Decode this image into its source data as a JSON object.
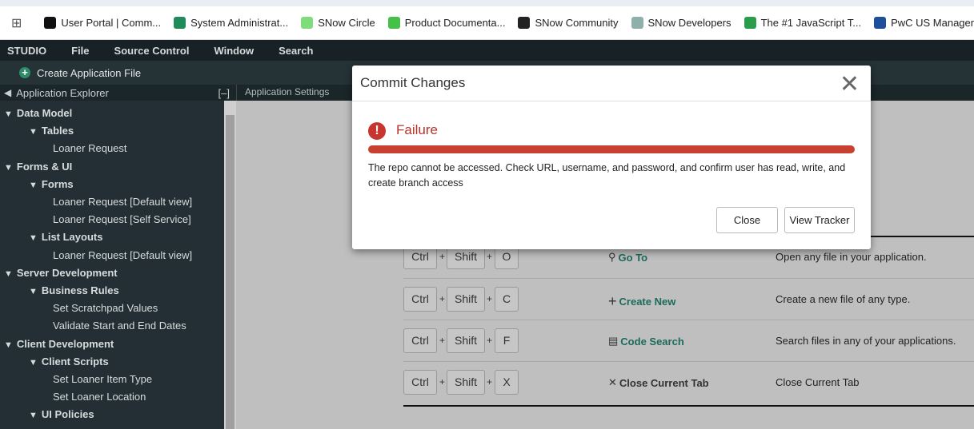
{
  "bookmarks": [
    {
      "label": "User Portal | Comm...",
      "color": "#111111"
    },
    {
      "label": "System Administrat...",
      "color": "#1f8a5a"
    },
    {
      "label": "SNow Circle",
      "color": "#7fdc7a"
    },
    {
      "label": "Product Documenta...",
      "color": "#45c14a"
    },
    {
      "label": "SNow Community",
      "color": "#222222"
    },
    {
      "label": "SNow Developers",
      "color": "#8fb0aa"
    },
    {
      "label": "The #1 JavaScript T...",
      "color": "#2a9d4a"
    },
    {
      "label": "PwC US Manageme...",
      "color": "#1e4f9a"
    }
  ],
  "menu": [
    "STUDIO",
    "File",
    "Source Control",
    "Window",
    "Search"
  ],
  "create_file": "Create Application File",
  "explorer": {
    "title": "Application Explorer",
    "collapse": "[–]"
  },
  "tab": "Application Settings",
  "tree": [
    {
      "label": "Data Model",
      "level": 0
    },
    {
      "label": "Tables",
      "level": 1
    },
    {
      "label": "Loaner Request",
      "level": 2
    },
    {
      "label": "Forms & UI",
      "level": 0
    },
    {
      "label": "Forms",
      "level": 1
    },
    {
      "label": "Loaner Request [Default view]",
      "level": 2
    },
    {
      "label": "Loaner Request [Self Service]",
      "level": 2
    },
    {
      "label": "List Layouts",
      "level": 1
    },
    {
      "label": "Loaner Request [Default view]",
      "level": 2
    },
    {
      "label": "Server Development",
      "level": 0
    },
    {
      "label": "Business Rules",
      "level": 1
    },
    {
      "label": "Set Scratchpad Values",
      "level": 2
    },
    {
      "label": "Validate Start and End Dates",
      "level": 2
    },
    {
      "label": "Client Development",
      "level": 0
    },
    {
      "label": "Client Scripts",
      "level": 1
    },
    {
      "label": "Set Loaner Item Type",
      "level": 2
    },
    {
      "label": "Set Loaner Location",
      "level": 2
    },
    {
      "label": "UI Policies",
      "level": 1
    }
  ],
  "shortcuts": [
    {
      "keys": [
        "Ctrl",
        "Shift",
        "O"
      ],
      "icon": "search-icon",
      "action": "Go To",
      "desc": "Open any file in your application."
    },
    {
      "keys": [
        "Ctrl",
        "Shift",
        "C"
      ],
      "icon": "plus-icon",
      "action": "Create New",
      "desc": "Create a new file of any type."
    },
    {
      "keys": [
        "Ctrl",
        "Shift",
        "F"
      ],
      "icon": "code-search-icon",
      "action": "Code Search",
      "desc": "Search files in any of your applications."
    },
    {
      "keys": [
        "Ctrl",
        "Shift",
        "X"
      ],
      "icon": "close-icon",
      "action": "Close Current Tab",
      "desc": "Close Current Tab"
    }
  ],
  "modal": {
    "title": "Commit Changes",
    "status": "Failure",
    "progress_percent": 100,
    "message": "The repo cannot be accessed. Check URL, username, and password, and confirm user has read, write, and create branch access",
    "close_button": "Close",
    "tracker_button": "View Tracker",
    "error_color": "#c8352e"
  }
}
